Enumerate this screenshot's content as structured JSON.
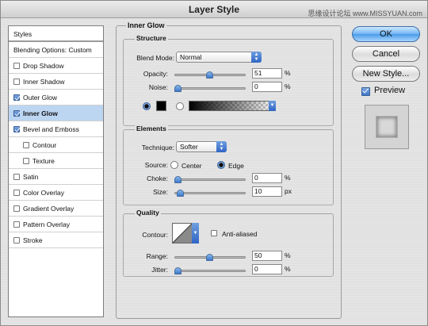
{
  "window": {
    "title": "Layer Style",
    "watermark": "思缘设计论坛 www.MISSYUAN.com"
  },
  "sidebar": {
    "items": [
      {
        "label": "Styles",
        "checkbox": false,
        "checked": false,
        "selected": false
      },
      {
        "label": "Blending Options: Custom",
        "checkbox": false,
        "checked": false,
        "selected": false
      },
      {
        "label": "Drop Shadow",
        "checkbox": true,
        "checked": false,
        "selected": false
      },
      {
        "label": "Inner Shadow",
        "checkbox": true,
        "checked": false,
        "selected": false
      },
      {
        "label": "Outer Glow",
        "checkbox": true,
        "checked": true,
        "selected": false
      },
      {
        "label": "Inner Glow",
        "checkbox": true,
        "checked": true,
        "selected": true
      },
      {
        "label": "Bevel and Emboss",
        "checkbox": true,
        "checked": true,
        "selected": false
      },
      {
        "label": "Contour",
        "checkbox": true,
        "checked": false,
        "selected": false,
        "indent": true
      },
      {
        "label": "Texture",
        "checkbox": true,
        "checked": false,
        "selected": false,
        "indent": true
      },
      {
        "label": "Satin",
        "checkbox": true,
        "checked": false,
        "selected": false
      },
      {
        "label": "Color Overlay",
        "checkbox": true,
        "checked": false,
        "selected": false
      },
      {
        "label": "Gradient Overlay",
        "checkbox": true,
        "checked": false,
        "selected": false
      },
      {
        "label": "Pattern Overlay",
        "checkbox": true,
        "checked": false,
        "selected": false
      },
      {
        "label": "Stroke",
        "checkbox": true,
        "checked": false,
        "selected": false
      }
    ]
  },
  "panel": {
    "title": "Inner Glow",
    "structure": {
      "title": "Structure",
      "blend_mode_label": "Blend Mode:",
      "blend_mode_value": "Normal",
      "opacity_label": "Opacity:",
      "opacity_value": "51",
      "opacity_level": 0.51,
      "noise_label": "Noise:",
      "noise_value": "0",
      "noise_level": 0,
      "percent": "%"
    },
    "elements": {
      "title": "Elements",
      "technique_label": "Technique:",
      "technique_value": "Softer",
      "source_label": "Source:",
      "source_center": "Center",
      "source_edge": "Edge",
      "choke_label": "Choke:",
      "choke_value": "0",
      "choke_level": 0,
      "size_label": "Size:",
      "size_value": "10",
      "size_level": 0.04,
      "percent": "%",
      "px": "px"
    },
    "quality": {
      "title": "Quality",
      "contour_label": "Contour:",
      "anti_aliased": "Anti-aliased",
      "range_label": "Range:",
      "range_value": "50",
      "range_level": 0.5,
      "jitter_label": "Jitter:",
      "jitter_value": "0",
      "jitter_level": 0,
      "percent": "%"
    }
  },
  "buttons": {
    "ok": "OK",
    "cancel": "Cancel",
    "new_style": "New Style...",
    "preview": "Preview"
  },
  "colors": {
    "accent": "#4a9be8",
    "selection": "#bcd6f2"
  }
}
